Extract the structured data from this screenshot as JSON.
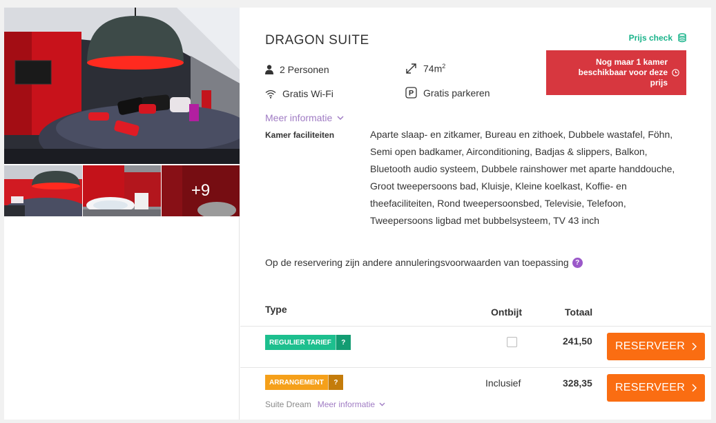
{
  "room": {
    "title": "DRAGON SUITE",
    "thumbs_more": "+9"
  },
  "features": {
    "persons": "2 Personen",
    "area": "74m",
    "area_sup": "2",
    "wifi": "Gratis Wi-Fi",
    "parking": "Gratis parkeren",
    "parking_icon_letter": "P"
  },
  "meer_informatie": "Meer informatie",
  "facilities": {
    "label": "Kamer faciliteiten",
    "text": "Aparte slaap- en zitkamer, Bureau en zithoek, Dubbele wastafel, Föhn, Semi open badkamer, Airconditioning, Badjas & slippers, Balkon, Bluetooth audio systeem, Dubbele rainshower met aparte handdouche, Groot tweepersoons bad, Kluisje, Kleine koelkast, Koffie- en theefaciliteiten, Rond tweepersoonsbed, Televisie, Telefoon, Tweepersoons ligbad met bubbelsysteem, TV 43 inch"
  },
  "prijs_check": "Prijs check",
  "alert": "Nog maar 1 kamer beschikbaar voor deze prijs",
  "cancellation": "Op de reservering zijn andere annuleringsvoorwaarden van toepassing",
  "question_mark": "?",
  "table": {
    "col_type": "Type",
    "col_ontbijt": "Ontbijt",
    "col_totaal": "Totaal",
    "rows": [
      {
        "badge": "REGULIER TARIEF",
        "badge_color": "#1dbf8e",
        "badge_q_color": "#139c72",
        "ontbijt_checked": false,
        "price": "241,50",
        "button": "RESERVEER"
      },
      {
        "badge": "ARRANGEMENT",
        "badge_color": "#f5a01a",
        "badge_q_color": "#c47c0b",
        "ontbijt": "Inclusief",
        "price": "328,35",
        "button": "RESERVEER",
        "package_name": "Suite Dream",
        "more": "Meer informatie"
      }
    ]
  },
  "colors": {
    "accent_orange": "#fa6d12",
    "alert_red": "#d7373f",
    "link_purple": "#a07cc4",
    "check_green": "#19b38a"
  }
}
